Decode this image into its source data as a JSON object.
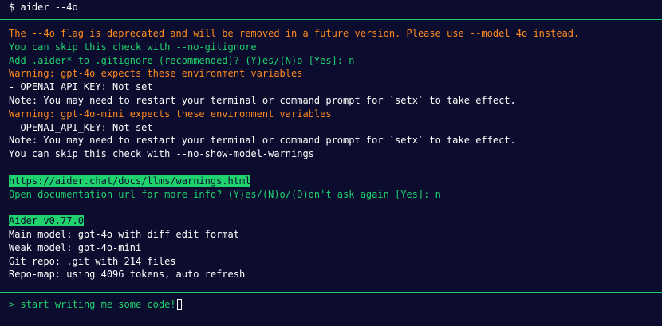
{
  "command": {
    "prompt_symbol": "$",
    "text": "aider --4o"
  },
  "colors": {
    "background": "#0c0c2e",
    "warning": "#ff8a1e",
    "info": "#1fd26e",
    "text": "#ffffff"
  },
  "messages": {
    "deprecation": "The --4o flag is deprecated and will be removed in a future version. Please use --model 4o instead.",
    "skip_gitignore": "You can skip this check with --no-gitignore",
    "add_gitignore_prompt": "Add .aider* to .gitignore (recommended)? (Y)es/(N)o [Yes]: n",
    "warn_gpt4o": "Warning: gpt-4o expects these environment variables",
    "env_var_1": "- OPENAI_API_KEY: Not set",
    "note_1": "Note: You may need to restart your terminal or command prompt for `setx` to take effect.",
    "warn_gpt4o_mini": "Warning: gpt-4o-mini expects these environment variables",
    "env_var_2": "- OPENAI_API_KEY: Not set",
    "note_2": "Note: You may need to restart your terminal or command prompt for `setx` to take effect.",
    "skip_model_warnings": "You can skip this check with --no-show-model-warnings",
    "docs_url": "https://aider.chat/docs/llms/warnings.html",
    "open_docs_prompt": "Open documentation url for more info? (Y)es/(N)o/(D)on't ask again [Yes]: n",
    "version": "Aider v0.77.0",
    "main_model": "Main model: gpt-4o with diff edit format",
    "weak_model": "Weak model: gpt-4o-mini",
    "git_repo": "Git repo: .git with 214 files",
    "repo_map": "Repo-map: using 4096 tokens, auto refresh"
  },
  "input": {
    "prompt_symbol": ">",
    "value": "start writing me some code!"
  }
}
